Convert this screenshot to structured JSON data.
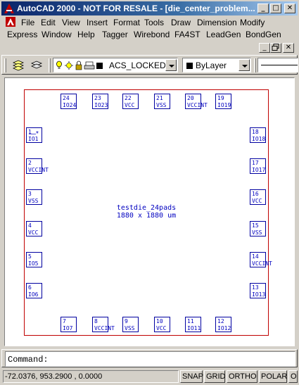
{
  "window": {
    "title": "AutoCAD 2000 - NOT FOR RESALE - [die_center_problem...",
    "buttons": {
      "minimize": "_",
      "maximize": "□",
      "close": "✕"
    }
  },
  "menu": {
    "row1": [
      "File",
      "Edit",
      "View",
      "Insert",
      "Format",
      "Tools",
      "Draw",
      "Dimension",
      "Modify"
    ],
    "row2": [
      "Express",
      "Window",
      "Help",
      "Tagger",
      "Wirebond",
      "FA4ST",
      "LeadGen",
      "BondGen"
    ]
  },
  "toolbar": {
    "layer_value": "ACS_LOCKED",
    "color_value": "ByLayer"
  },
  "drawing": {
    "die_label_line1": "testdie_24pads",
    "die_label_line2": "1880 x 1880 um",
    "marker_glyph": "—*",
    "top_pads": [
      {
        "num": "24",
        "name": "IO24"
      },
      {
        "num": "23",
        "name": "IO23"
      },
      {
        "num": "22",
        "name": "VCC"
      },
      {
        "num": "21",
        "name": "VSS"
      },
      {
        "num": "20",
        "name": "VCCINT"
      },
      {
        "num": "19",
        "name": "IO19"
      }
    ],
    "left_pads": [
      {
        "num": "1",
        "name": "IO1"
      },
      {
        "num": "2",
        "name": "VCCINT"
      },
      {
        "num": "3",
        "name": "VSS"
      },
      {
        "num": "4",
        "name": "VCC"
      },
      {
        "num": "5",
        "name": "IO5"
      },
      {
        "num": "6",
        "name": "IO6"
      }
    ],
    "right_pads": [
      {
        "num": "18",
        "name": "IO18"
      },
      {
        "num": "17",
        "name": "IO17"
      },
      {
        "num": "16",
        "name": "VCC"
      },
      {
        "num": "15",
        "name": "VSS"
      },
      {
        "num": "14",
        "name": "VCCINT"
      },
      {
        "num": "13",
        "name": "IO13"
      }
    ],
    "bottom_pads": [
      {
        "num": "7",
        "name": "IO7"
      },
      {
        "num": "8",
        "name": "VCCINT"
      },
      {
        "num": "9",
        "name": "VSS"
      },
      {
        "num": "10",
        "name": "VCC"
      },
      {
        "num": "11",
        "name": "IO11"
      },
      {
        "num": "12",
        "name": "IO12"
      }
    ]
  },
  "command": {
    "prompt": "Command:"
  },
  "status": {
    "coords": "-72.0376,  953.2900 , 0.0000",
    "snap": "SNAP",
    "grid": "GRID",
    "ortho": "ORTHO",
    "polar": "POLAR",
    "osnap": "O"
  },
  "colors": {
    "title_active": "#0a246a",
    "die_outline": "#c00000",
    "pad_blue": "#0000c0"
  }
}
